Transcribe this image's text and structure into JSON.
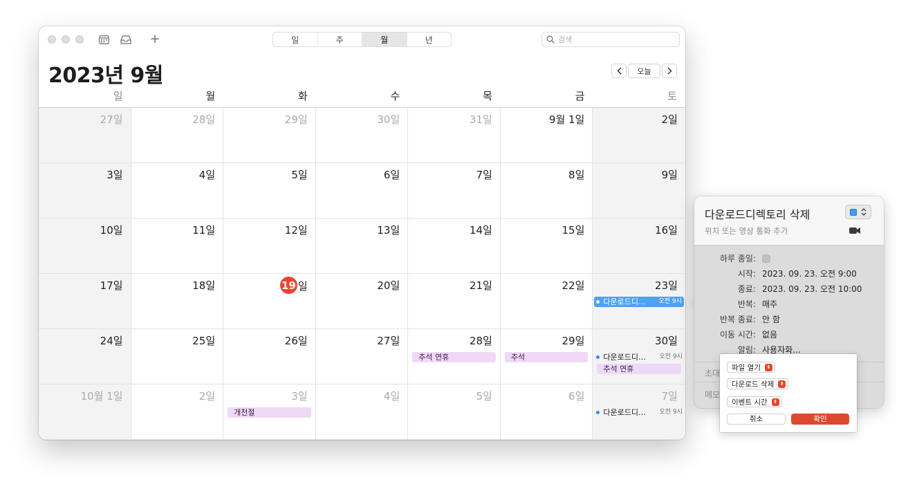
{
  "toolbar": {
    "view_tabs": [
      {
        "label": "일",
        "active": false
      },
      {
        "label": "주",
        "active": false
      },
      {
        "label": "월",
        "active": true
      },
      {
        "label": "년",
        "active": false
      }
    ],
    "search_placeholder": "검색",
    "icons": {
      "calendar_list": "calendar-list-icon",
      "inbox": "inbox-icon",
      "add": "plus-icon",
      "search": "magnifier-icon"
    }
  },
  "header": {
    "title": "2023년 9월",
    "prev_label": "‹",
    "today_label": "오늘",
    "next_label": "›"
  },
  "weekdays": [
    "일",
    "월",
    "화",
    "수",
    "목",
    "금",
    "토"
  ],
  "weeks": [
    [
      {
        "label": "27일",
        "muted": true,
        "weekend": true
      },
      {
        "label": "28일",
        "muted": true
      },
      {
        "label": "29일",
        "muted": true
      },
      {
        "label": "30일",
        "muted": true
      },
      {
        "label": "31일",
        "muted": true
      },
      {
        "label": "9월 1일",
        "muted": false
      },
      {
        "label": "2일",
        "muted": false,
        "weekend": true
      }
    ],
    [
      {
        "label": "3일",
        "weekend": true
      },
      {
        "label": "4일"
      },
      {
        "label": "5일"
      },
      {
        "label": "6일"
      },
      {
        "label": "7일"
      },
      {
        "label": "8일"
      },
      {
        "label": "9일",
        "weekend": true
      }
    ],
    [
      {
        "label": "10일",
        "weekend": true
      },
      {
        "label": "11일"
      },
      {
        "label": "12일"
      },
      {
        "label": "13일"
      },
      {
        "label": "14일"
      },
      {
        "label": "15일"
      },
      {
        "label": "16일",
        "weekend": true
      }
    ],
    [
      {
        "label": "17일",
        "weekend": true
      },
      {
        "label": "18일"
      },
      {
        "label": "19일",
        "today": true,
        "today_num": "19",
        "today_suffix": "일"
      },
      {
        "label": "20일"
      },
      {
        "label": "21일"
      },
      {
        "label": "22일"
      },
      {
        "label": "23일",
        "weekend": true,
        "events": [
          {
            "kind": "dot",
            "title": "다운로드디…",
            "time": "오전 9시",
            "selected": true
          }
        ]
      }
    ],
    [
      {
        "label": "24일",
        "weekend": true
      },
      {
        "label": "25일"
      },
      {
        "label": "26일"
      },
      {
        "label": "27일"
      },
      {
        "label": "28일",
        "events": [
          {
            "kind": "bar",
            "title": "추석 연휴"
          }
        ]
      },
      {
        "label": "29일",
        "events": [
          {
            "kind": "bar",
            "title": "추석"
          }
        ]
      },
      {
        "label": "30일",
        "weekend": true,
        "events": [
          {
            "kind": "dot",
            "title": "다운로드디…",
            "time": "오전 9시"
          },
          {
            "kind": "bar",
            "title": "추석 연휴"
          }
        ]
      }
    ],
    [
      {
        "label": "10월 1일",
        "muted": true,
        "weekend": true
      },
      {
        "label": "2일",
        "muted": true
      },
      {
        "label": "3일",
        "muted": true,
        "events": [
          {
            "kind": "bar",
            "title": "개천절"
          }
        ]
      },
      {
        "label": "4일",
        "muted": true
      },
      {
        "label": "5일",
        "muted": true
      },
      {
        "label": "6일",
        "muted": true
      },
      {
        "label": "7일",
        "muted": true,
        "weekend": true,
        "events": [
          {
            "kind": "dot",
            "title": "다운로드디…",
            "time": "오전 9시"
          }
        ]
      }
    ]
  ],
  "inspector": {
    "title": "다운로드디렉토리 삭제",
    "location_placeholder": "위치 또는 영상 통화 추가",
    "calendar_color": "#3e9cf3",
    "rows": [
      {
        "label": "하루 종일:",
        "value": ""
      },
      {
        "label": "시작:",
        "value": "2023. 09. 23.   오전   9:00"
      },
      {
        "label": "종료:",
        "value": "2023. 09. 23.   오전 10:00"
      },
      {
        "label": "반복:",
        "value": "매주"
      },
      {
        "label": "반복 종료:",
        "value": "안 함"
      },
      {
        "label": "이동 시간:",
        "value": "없음"
      },
      {
        "label": "알림:",
        "value": "사용자화..."
      }
    ],
    "invitees_stub": "초대",
    "notes_stub": "메모"
  },
  "alert_panel": {
    "action_popup": "파일 열기",
    "file_popup": "다운로드 삭제",
    "timing_popup": "이벤트 시간",
    "cancel_label": "취소",
    "ok_label": "확인"
  }
}
